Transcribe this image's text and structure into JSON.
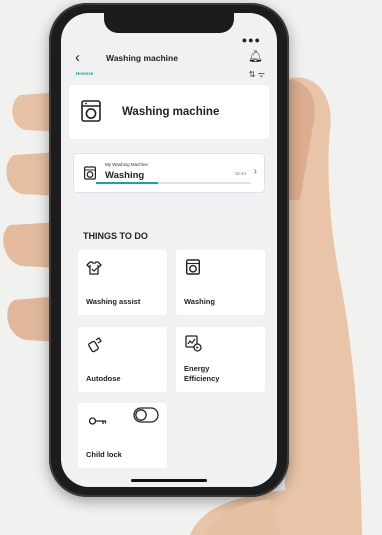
{
  "appbar": {
    "back_icon": "back-arrow-icon",
    "title": "Washing machine",
    "bell_icon": "bell-icon",
    "brand": "Hisense"
  },
  "hero": {
    "icon": "washing-machine-icon",
    "title": "Washing machine"
  },
  "status_card": {
    "icon": "washing-machine-icon",
    "subtitle": "My Washing Machine",
    "status": "Washing",
    "time": "15:44",
    "progress": 0.4
  },
  "section": {
    "title": "THINGS TO DO"
  },
  "tiles": [
    {
      "label": "Washing assist",
      "icon": "shirt-assist-icon"
    },
    {
      "label": "Washing",
      "icon": "washing-machine-icon"
    },
    {
      "label": "Autodose",
      "icon": "dose-bottle-icon"
    },
    {
      "label": "Energy Efficiency",
      "icon": "energy-chart-icon"
    },
    {
      "label": "Child lock",
      "icon": "key-icon",
      "toggle_on": false
    }
  ],
  "colors": {
    "accent": "#1aa2a0",
    "screen_bg": "#f0f1f3",
    "card_bg": "#ffffff"
  }
}
